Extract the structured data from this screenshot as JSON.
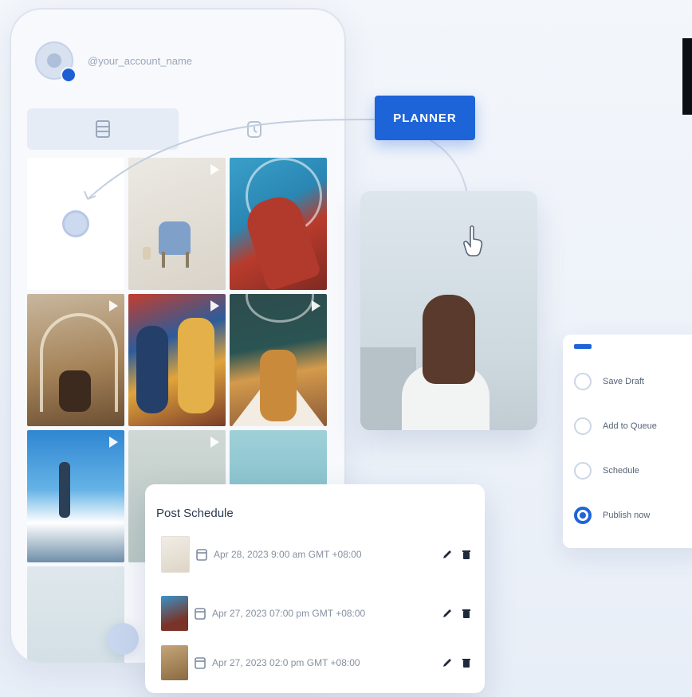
{
  "profile": {
    "handle": "@your_account_name"
  },
  "planner": {
    "label": "PLANNER"
  },
  "publish_options": {
    "selected": "Publish now",
    "items": [
      {
        "label": "Save Draft",
        "checked": false
      },
      {
        "label": "Add to Queue",
        "checked": false
      },
      {
        "label": "Schedule",
        "checked": false
      },
      {
        "label": "Publish now",
        "checked": true
      }
    ]
  },
  "post_schedule": {
    "title": "Post Schedule",
    "rows": [
      {
        "text": "Apr 28, 2023 9:00 am  GMT +08:00"
      },
      {
        "text": "Apr 27, 2023 07:00 pm  GMT +08:00"
      },
      {
        "text": "Apr 27, 2023 02:0 pm  GMT +08:00"
      }
    ]
  },
  "colors": {
    "accent": "#1e64d9",
    "background": "#eef3f9",
    "card": "#ffffff"
  },
  "icons": {
    "grid_tab": "grid-icon",
    "schedule_tab": "calendar-clock-icon",
    "cursor": "hand-pointer-icon",
    "edit": "pencil-icon",
    "delete": "trash-icon",
    "calendar": "calendar-icon",
    "video": "play-icon"
  }
}
